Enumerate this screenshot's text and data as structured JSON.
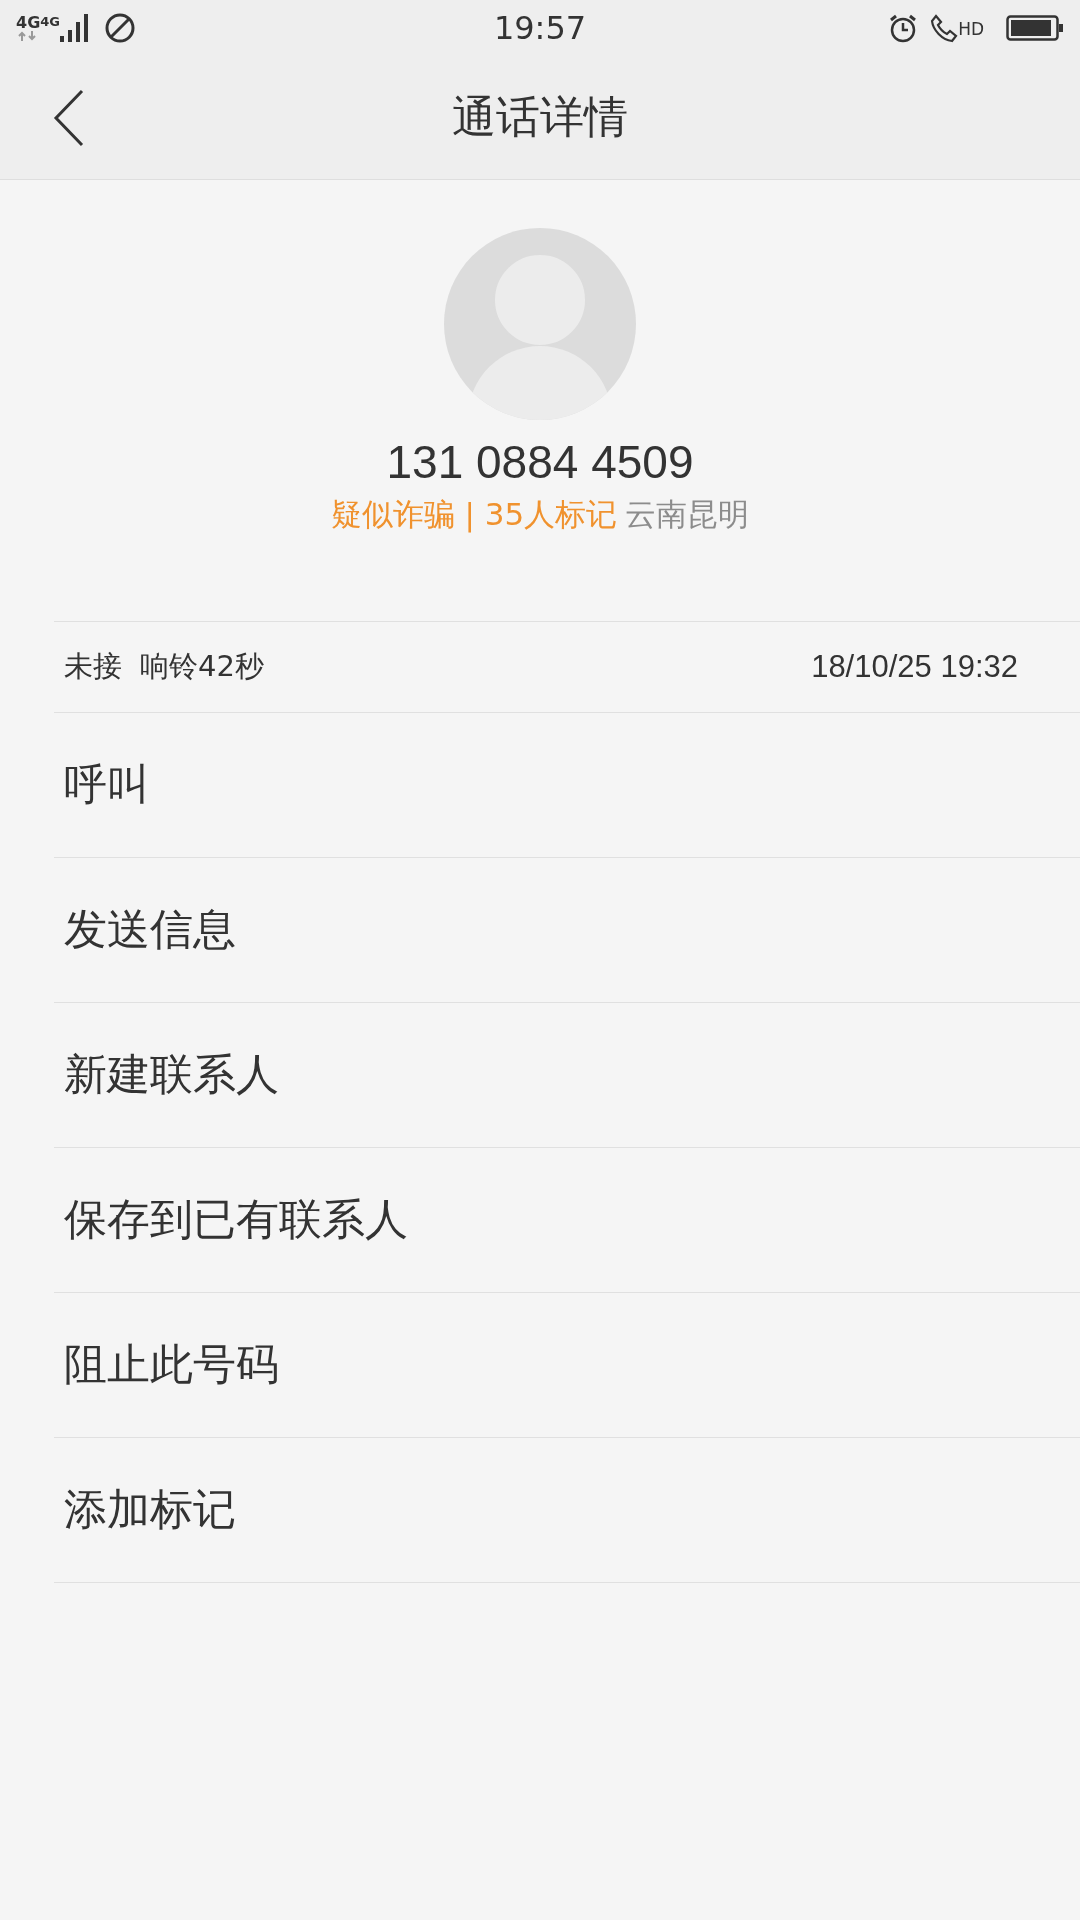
{
  "status_bar": {
    "network": [
      "4G",
      "4G"
    ],
    "time": "19:57",
    "call_quality": "HD"
  },
  "header": {
    "title": "通话详情"
  },
  "contact": {
    "number": "131 0884 4509",
    "tag": "疑似诈骗 | 35人标记",
    "location": "云南昆明"
  },
  "call_record": {
    "status": "未接",
    "ring": "响铃42秒",
    "datetime": "18/10/25 19:32"
  },
  "actions": [
    "呼叫",
    "发送信息",
    "新建联系人",
    "保存到已有联系人",
    "阻止此号码",
    "添加标记"
  ]
}
